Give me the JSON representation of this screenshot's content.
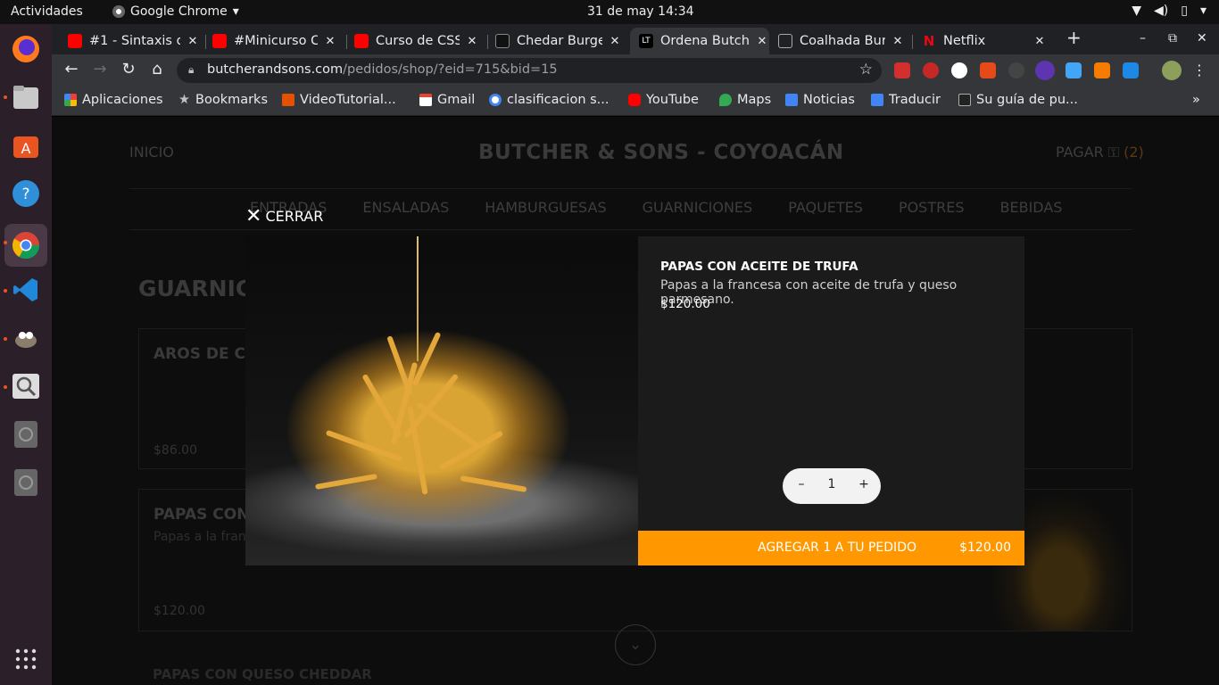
{
  "system": {
    "activities": "Actividades",
    "app_name": "Google Chrome",
    "clock": "31 de may  14:34"
  },
  "tabs": [
    {
      "title": "#1 - Sintaxis d",
      "favicon": "youtube",
      "active": false
    },
    {
      "title": "#Minicurso CS",
      "favicon": "youtube",
      "active": false
    },
    {
      "title": "Curso de CSS",
      "favicon": "youtube",
      "active": false
    },
    {
      "title": "Chedar Burge",
      "favicon": "burger",
      "active": false
    },
    {
      "title": "Ordena Butch",
      "favicon": "lt",
      "active": true
    },
    {
      "title": "Coalhada Bur",
      "favicon": "generic",
      "active": false
    },
    {
      "title": "Netflix",
      "favicon": "netflix",
      "active": false
    }
  ],
  "address_bar": {
    "host": "butcherandsons.com",
    "path": "/pedidos/shop/?eid=715&bid=15"
  },
  "bookmarks": [
    {
      "label": "Aplicaciones",
      "icon": "apps-grid-icon"
    },
    {
      "label": "Bookmarks",
      "icon": "star-icon"
    },
    {
      "label": "VideoTutorial...",
      "icon": "video-icon"
    },
    {
      "label": "Gmail",
      "icon": "gmail-icon"
    },
    {
      "label": "clasificacion s...",
      "icon": "google-icon"
    },
    {
      "label": "YouTube",
      "icon": "youtube-icon"
    },
    {
      "label": "Maps",
      "icon": "maps-icon"
    },
    {
      "label": "Noticias",
      "icon": "news-icon"
    },
    {
      "label": "Traducir",
      "icon": "translate-icon"
    },
    {
      "label": "Su guía de pu...",
      "icon": "page-icon"
    }
  ],
  "site": {
    "nav_home": "INICIO",
    "brand": "BUTCHER & SONS - COYOACÁN",
    "nav_pay": "PAGAR",
    "cart_count": "(2)",
    "categories": [
      "ENTRADAS",
      "ENSALADAS",
      "HAMBURGUESAS",
      "GUARNICIONES",
      "PAQUETES",
      "POSTRES",
      "BEBIDAS"
    ],
    "section_title": "GUARNICIONES",
    "cards": [
      {
        "name": "AROS DE CE",
        "desc": "",
        "price": "$86.00"
      },
      {
        "name": "PAPAS CON",
        "desc": "Papas a la franc",
        "price": "$120.00"
      }
    ],
    "card3_name": "PAPAS CON QUESO CHEDDAR"
  },
  "modal": {
    "close_label": "CERRAR",
    "product_name": "PAPAS CON ACEITE DE TRUFA",
    "product_desc": "Papas a la francesa con aceite de trufa y queso parmesano.",
    "product_price": "$120.00",
    "qty_minus": "–",
    "qty_value": "1",
    "qty_plus": "+",
    "add_label": "AGREGAR 1 A TU PEDIDO",
    "add_amount": "$120.00"
  },
  "colors": {
    "accent": "#ff9800",
    "modal_panel": "#1b1b1b",
    "chrome_dark": "#202124",
    "dock": "#2b2029"
  }
}
